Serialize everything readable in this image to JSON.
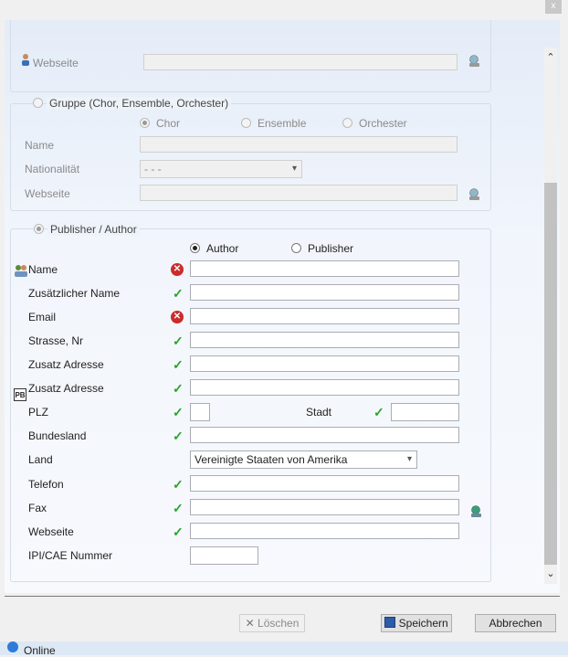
{
  "window": {
    "close_glyph": "x"
  },
  "person_section": {
    "webseite_label": "Webseite",
    "webseite_value": ""
  },
  "gruppe_section": {
    "legend": "Gruppe (Chor, Ensemble, Orchester)",
    "selected": false,
    "options": [
      "Chor",
      "Ensemble",
      "Orchester"
    ],
    "selected_option": "Chor",
    "name_label": "Name",
    "name_value": "",
    "nationalitaet_label": "Nationalität",
    "nationalitaet_value": "- - -",
    "webseite_label": "Webseite",
    "webseite_value": ""
  },
  "publisher_section": {
    "legend": "Publisher / Author",
    "selected": true,
    "options": [
      "Author",
      "Publisher"
    ],
    "selected_option": "Author",
    "fields": {
      "name": {
        "label": "Name",
        "value": "",
        "status": "error"
      },
      "zusaetzlicher_name": {
        "label": "Zusätzlicher Name",
        "value": "",
        "status": "ok"
      },
      "email": {
        "label": "Email",
        "value": "",
        "status": "error"
      },
      "strasse": {
        "label": "Strasse, Nr",
        "value": "",
        "status": "ok"
      },
      "zusatz_adresse_1": {
        "label": "Zusatz Adresse",
        "value": "",
        "status": "ok"
      },
      "zusatz_adresse_2": {
        "label": "Zusatz Adresse",
        "value": "",
        "status": "ok"
      },
      "plz": {
        "label": "PLZ",
        "value": "",
        "status": "ok"
      },
      "stadt": {
        "label": "Stadt",
        "value": "",
        "status": "ok"
      },
      "bundesland": {
        "label": "Bundesland",
        "value": "",
        "status": "ok"
      },
      "land": {
        "label": "Land",
        "value": "Vereinigte Staaten von Amerika"
      },
      "telefon": {
        "label": "Telefon",
        "value": "",
        "status": "ok"
      },
      "fax": {
        "label": "Fax",
        "value": "",
        "status": "ok"
      },
      "webseite": {
        "label": "Webseite",
        "value": "",
        "status": "ok"
      },
      "ipi": {
        "label": "IPI/CAE Nummer",
        "value": ""
      }
    }
  },
  "buttons": {
    "loeschen": "Löschen",
    "speichern": "Speichern",
    "abbrechen": "Abbrechen"
  },
  "status": {
    "text": "Online"
  },
  "icons": {
    "check": "✓",
    "error": "✕",
    "pb": "PB"
  },
  "colors": {
    "ok": "#2aa42a",
    "error": "#cc2b2b"
  }
}
